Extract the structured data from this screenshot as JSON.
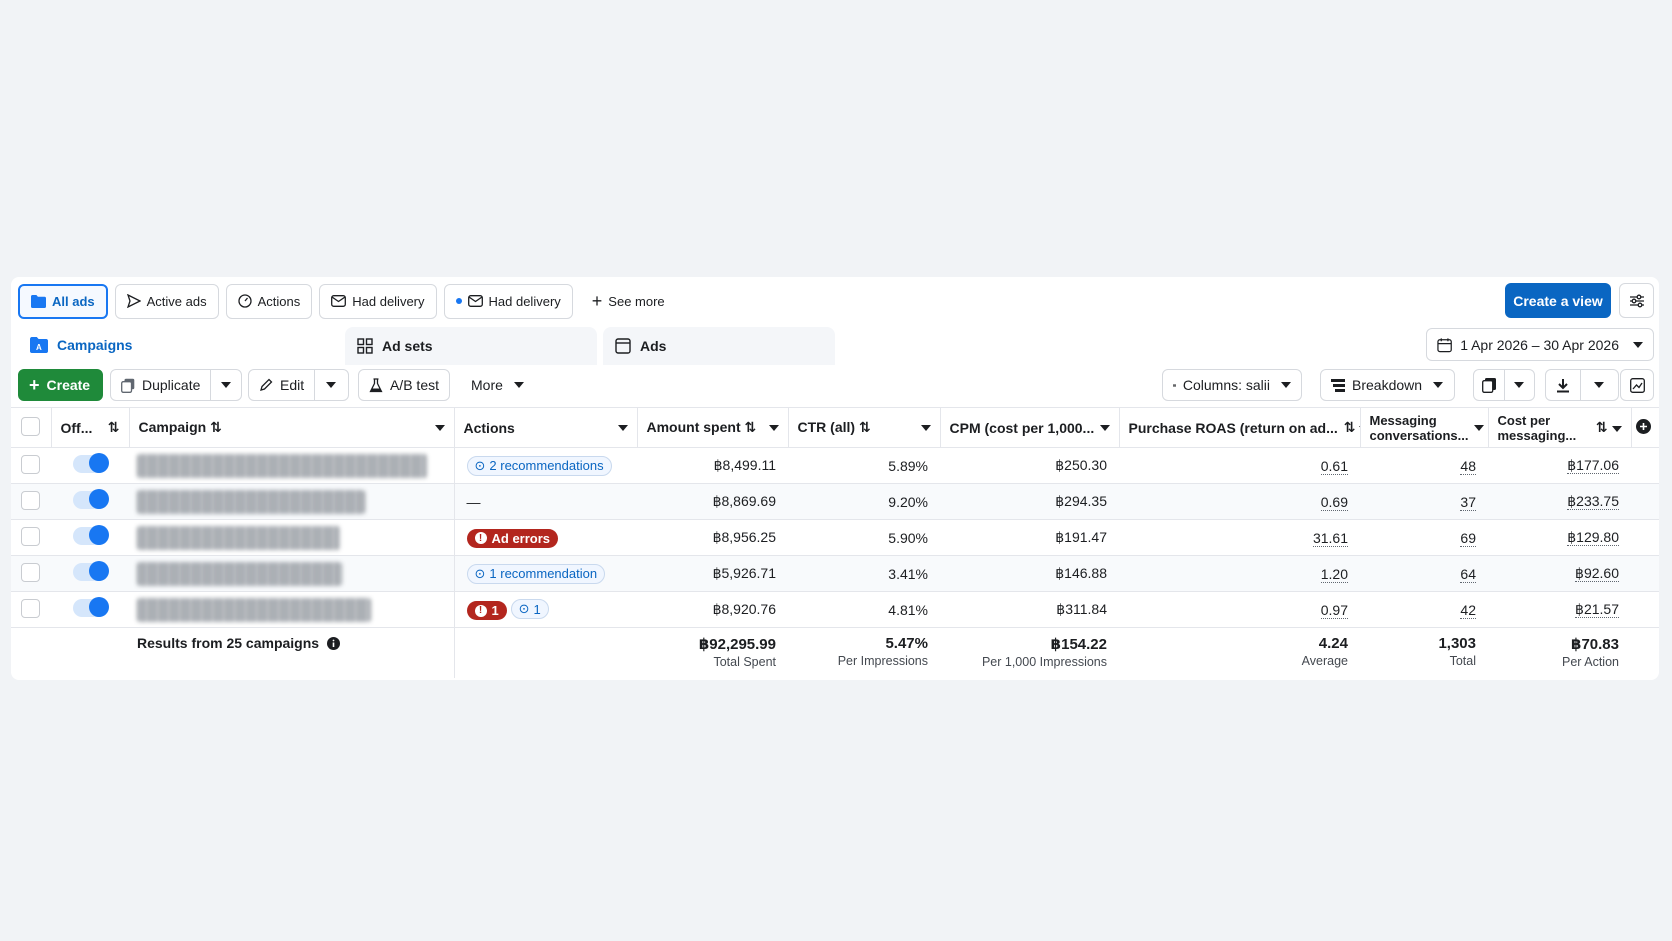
{
  "views": [
    {
      "label": "All ads",
      "active": true,
      "icon": "folder-icon"
    },
    {
      "label": "Active ads",
      "icon": "send-icon"
    },
    {
      "label": "Actions",
      "icon": "gauge-icon"
    },
    {
      "label": "Had delivery",
      "icon": "envelope-icon"
    },
    {
      "label": "Had delivery",
      "icon": "envelope-icon",
      "dot": true
    },
    {
      "label": "See more",
      "icon": "plus-icon"
    }
  ],
  "create_view_label": "Create a view",
  "tabs": {
    "campaigns": "Campaigns",
    "adsets": "Ad sets",
    "ads": "Ads"
  },
  "date_range": "1 Apr 2026 – 30 Apr 2026",
  "toolbar": {
    "create": "Create",
    "duplicate": "Duplicate",
    "edit": "Edit",
    "ab_test": "A/B test",
    "more": "More",
    "columns": "Columns: salii",
    "breakdown": "Breakdown"
  },
  "columns": {
    "off": "Off...",
    "campaign": "Campaign",
    "actions": "Actions",
    "amount_spent": "Amount spent",
    "ctr": "CTR (all)",
    "cpm": "CPM (cost per 1,000...",
    "roas": "Purchase ROAS (return on ad...",
    "messaging_1": "Messaging",
    "messaging_2": "conversations...",
    "cost_1": "Cost per",
    "cost_2": "messaging..."
  },
  "rows": [
    {
      "actions": "2 recommendations",
      "amount": "฿8,499.11",
      "ctr": "5.89%",
      "cpm": "฿250.30",
      "roas": "0.61",
      "msg": "48",
      "cost": "฿177.06"
    },
    {
      "actions": "—",
      "amount": "฿8,869.69",
      "ctr": "9.20%",
      "cpm": "฿294.35",
      "roas": "0.69",
      "msg": "37",
      "cost": "฿233.75"
    },
    {
      "actions": "Ad errors",
      "amount": "฿8,956.25",
      "ctr": "5.90%",
      "cpm": "฿191.47",
      "roas": "31.61",
      "msg": "69",
      "cost": "฿129.80"
    },
    {
      "actions": "1 recommendation",
      "amount": "฿5,926.71",
      "ctr": "3.41%",
      "cpm": "฿146.88",
      "roas": "1.20",
      "msg": "64",
      "cost": "฿92.60"
    },
    {
      "actions_err": "1",
      "actions_rec": "1",
      "amount": "฿8,920.76",
      "ctr": "4.81%",
      "cpm": "฿311.84",
      "roas": "0.97",
      "msg": "42",
      "cost": "฿21.57"
    }
  ],
  "footer": {
    "results": "Results from 25 campaigns",
    "amount": "฿92,295.99",
    "amount_sub": "Total Spent",
    "ctr": "5.47%",
    "ctr_sub": "Per Impressions",
    "cpm": "฿154.22",
    "cpm_sub": "Per 1,000 Impressions",
    "roas": "4.24",
    "roas_sub": "Average",
    "msg": "1,303",
    "msg_sub": "Total",
    "cost": "฿70.83",
    "cost_sub": "Per Action"
  },
  "colors": {
    "accent": "#0a66c2",
    "create": "#1f8a3a",
    "error": "#b3261e"
  }
}
